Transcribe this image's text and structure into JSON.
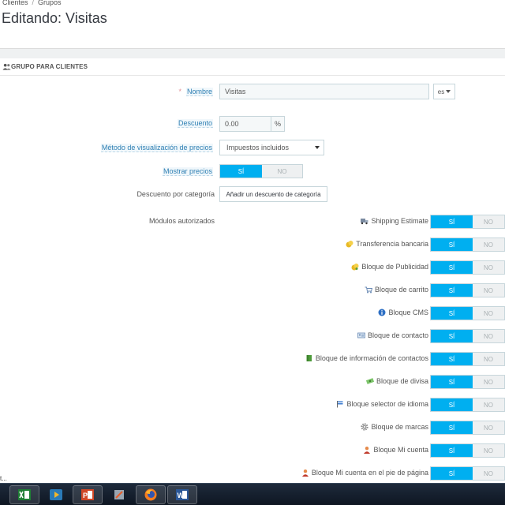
{
  "breadcrumb": {
    "item1": "Clientes",
    "separator": "/",
    "item2": "Grupos"
  },
  "page": {
    "title": "Editando: Visitas"
  },
  "panel": {
    "header": "GRUPO PARA CLIENTES",
    "header_icon": "users-icon"
  },
  "form": {
    "nombre": {
      "required_mark": "*",
      "label": "Nombre",
      "value": "Visitas",
      "lang": "es"
    },
    "descuento": {
      "label": "Descuento",
      "value": "0.00",
      "unit": "%"
    },
    "metodo": {
      "label": "Método de visualización de precios",
      "value": "Impuestos incluidos"
    },
    "mostrar": {
      "label": "Mostrar precios",
      "yes": "SÍ",
      "no": "NO",
      "selected": "yes"
    },
    "descuento_categoria": {
      "label": "Descuento por categoría",
      "button": "Añadir un descuento de categoría"
    },
    "modulos_label": "Módulos autorizados"
  },
  "modules": [
    {
      "label": "Shipping Estimate",
      "icon": "truck-icon",
      "on": "SÍ",
      "off": "NO"
    },
    {
      "label": "Transferencia bancaria",
      "icon": "coins-icon",
      "on": "SÍ",
      "off": "NO"
    },
    {
      "label": "Bloque de Publicidad",
      "icon": "coins-icon",
      "on": "SÍ",
      "off": "NO"
    },
    {
      "label": "Bloque de carrito",
      "icon": "cart-icon",
      "on": "SÍ",
      "off": "NO"
    },
    {
      "label": "Bloque CMS",
      "icon": "info-icon",
      "on": "SÍ",
      "off": "NO"
    },
    {
      "label": "Bloque de contacto",
      "icon": "contact-card-icon",
      "on": "SÍ",
      "off": "NO"
    },
    {
      "label": "Bloque de información de contactos",
      "icon": "book-icon",
      "on": "SÍ",
      "off": "NO"
    },
    {
      "label": "Bloque de divisa",
      "icon": "money-icon",
      "on": "SÍ",
      "off": "NO"
    },
    {
      "label": "Bloque selector de idioma",
      "icon": "flag-icon",
      "on": "SÍ",
      "off": "NO"
    },
    {
      "label": "Bloque de marcas",
      "icon": "gear-icon",
      "on": "SÍ",
      "off": "NO"
    },
    {
      "label": "Bloque Mi cuenta",
      "icon": "user-icon",
      "on": "SÍ",
      "off": "NO"
    },
    {
      "label": "Bloque Mi cuenta en el pie de página",
      "icon": "user-icon",
      "on": "SÍ",
      "off": "NO"
    }
  ],
  "status_text": "t...",
  "taskbar": [
    "excel-icon",
    "media-player-icon",
    "powerpoint-icon",
    "tool-icon",
    "firefox-icon",
    "word-icon"
  ],
  "colors": {
    "accent": "#00aff0",
    "hint_label": "#2e7fb3",
    "taskbar": "#1e2a3b"
  }
}
